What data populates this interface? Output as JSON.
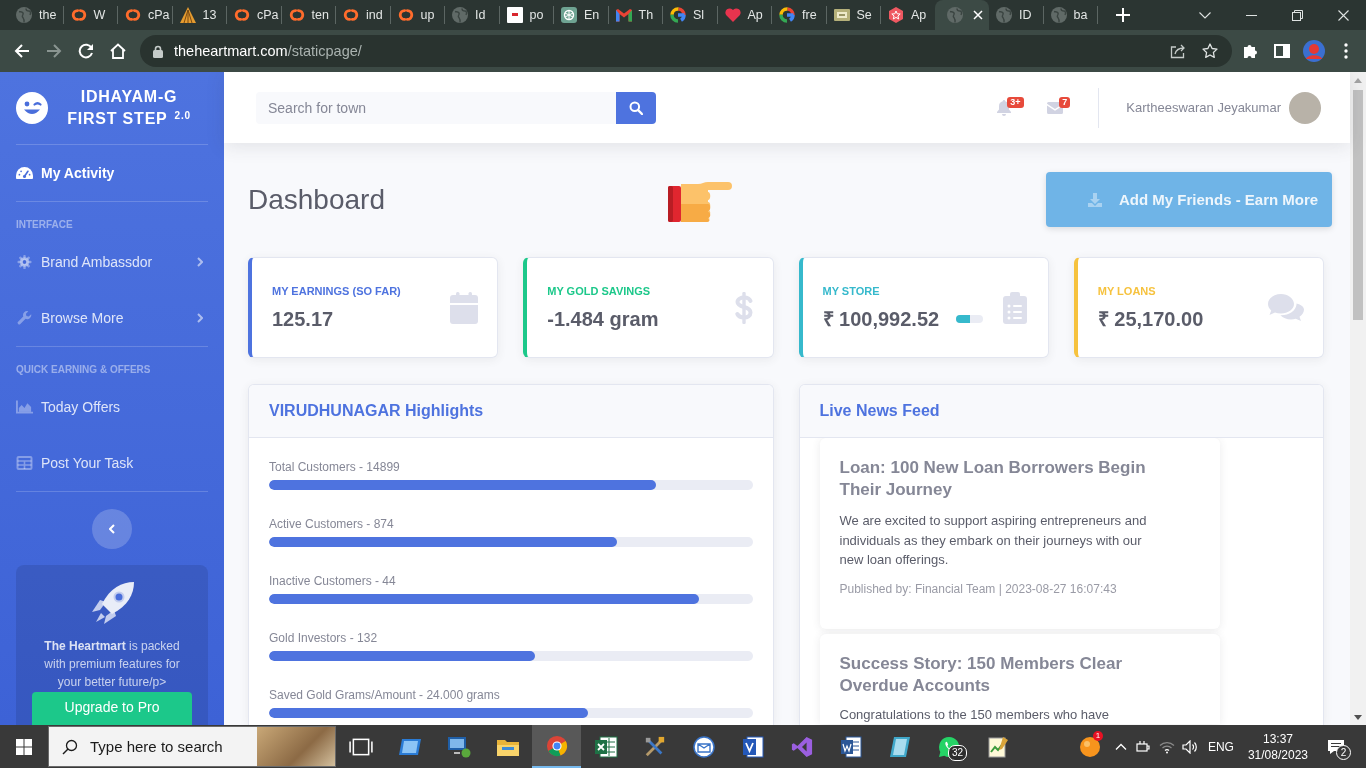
{
  "browser": {
    "tabs": [
      {
        "label": "the",
        "kind": "globe",
        "selected": false
      },
      {
        "label": "W",
        "kind": "arcs",
        "selected": false
      },
      {
        "label": "cPa",
        "kind": "arcs",
        "selected": false
      },
      {
        "label": "13",
        "kind": "tent",
        "selected": false
      },
      {
        "label": "cPa",
        "kind": "arcs",
        "selected": false
      },
      {
        "label": "ten",
        "kind": "arcs",
        "selected": false
      },
      {
        "label": "ind",
        "kind": "arcs",
        "selected": false
      },
      {
        "label": "up",
        "kind": "arcs",
        "selected": false
      },
      {
        "label": "Id",
        "kind": "globe",
        "selected": false
      },
      {
        "label": "po",
        "kind": "square",
        "selected": false
      },
      {
        "label": "En",
        "kind": "knot",
        "selected": false
      },
      {
        "label": "Th",
        "kind": "mail",
        "selected": false
      },
      {
        "label": "Sl",
        "kind": "ring",
        "selected": false
      },
      {
        "label": "Ap",
        "kind": "heart",
        "selected": false
      },
      {
        "label": "fre",
        "kind": "ring",
        "selected": false
      },
      {
        "label": "Se",
        "kind": "card",
        "selected": false
      },
      {
        "label": "Ap",
        "kind": "hexagon",
        "selected": false
      },
      {
        "kind": "globe",
        "selected": true
      },
      {
        "label": "ID",
        "kind": "globe",
        "selected": false
      },
      {
        "label": "ba",
        "kind": "globe",
        "selected": false
      }
    ],
    "address": {
      "host": "theheartmart.com",
      "path": "/staticpage/"
    }
  },
  "sidebar": {
    "brand": {
      "line1": "IDHAYAM-G",
      "line2": "FIRST STEP $^{2.0}$"
    },
    "nav": [
      {
        "kind": "link",
        "label": "My Activity",
        "selected": true,
        "expandable": false
      },
      {
        "kind": "heading",
        "label": "INTERFACE"
      },
      {
        "kind": "link",
        "label": "Brand Ambassdor",
        "selected": false,
        "expandable": true
      },
      {
        "kind": "link",
        "label": "Browse More",
        "selected": false,
        "expandable": true
      },
      {
        "kind": "heading",
        "label": "QUICK EARNING & OFFERS"
      },
      {
        "kind": "link",
        "label": "Today Offers",
        "selected": false,
        "expandable": false
      },
      {
        "kind": "link",
        "label": "Post Your Task",
        "selected": false,
        "expandable": false
      }
    ],
    "promo": {
      "text": "**The Heartmart** is packed with premium features for your better future/p>",
      "button": "Upgrade to Pro"
    }
  },
  "topbar": {
    "search": {
      "placeholder": "Search for town"
    },
    "alerts_badge": "3+",
    "messages_badge": "7",
    "user_name": "Kartheeswaran Jeyakumar"
  },
  "dashboard": {
    "title": "Dashboard",
    "action_button": "Add My Friends - Earn More",
    "stat_cards": [
      {
        "label": "MY EARNINGS (SO FAR)",
        "value": "125.17",
        "color": "#4e73df"
      },
      {
        "label": "MY GOLD SAVINGS",
        "value": "-1.484 gram",
        "color": "#1cc88a"
      },
      {
        "label": "MY STORE",
        "value": "₹ 100,992.52",
        "color": "#36b9cc",
        "level": 0.5
      },
      {
        "label": "MY LOANS",
        "value": "₹ 25,170.00",
        "color": "#f6c23e"
      }
    ],
    "highlights": {
      "title": "VIRUDHUNAGAR Highlights",
      "bars": [
        {
          "label": "Total Customers - 14899",
          "level": 0.8
        },
        {
          "label": "Active Customers - 874",
          "level": 0.72
        },
        {
          "label": "Inactive Customers - 44",
          "level": 0.89
        },
        {
          "label": "Gold Investors - 132",
          "level": 0.55
        },
        {
          "label": "Saved Gold Grams/Amount - 24.000 grams",
          "level": 0.66
        }
      ]
    },
    "news_feed": {
      "title": "Live News Feed",
      "posts": [
        {
          "title": "Loan: 100 New Loan Borrowers Begin Their Journey",
          "body": "We are excited to support aspiring entrepreneurs and individuals as they embark on their journeys with our new loan offerings.",
          "meta": "Published by: Financial Team | 2023-08-27 16:07:43"
        },
        {
          "title": "Success Story: 150 Members Clear Overdue Accounts",
          "body": "Congratulations to the 150 members who have"
        }
      ]
    }
  },
  "taskbar": {
    "search": {
      "placeholder": "Type here to search"
    },
    "apps": [
      {
        "kind": "taskview",
        "selected": false
      },
      {
        "kind": "tablet",
        "selected": false
      },
      {
        "kind": "monitor",
        "selected": false
      },
      {
        "kind": "folder",
        "selected": false
      },
      {
        "kind": "ball",
        "selected": true
      },
      {
        "kind": "sheet",
        "selected": false
      },
      {
        "kind": "tools",
        "selected": false
      },
      {
        "kind": "mail",
        "selected": false
      },
      {
        "kind": "tile",
        "selected": false
      },
      {
        "kind": "ribbon",
        "selected": false
      },
      {
        "kind": "doc",
        "selected": false
      },
      {
        "kind": "glass",
        "selected": false
      },
      {
        "kind": "chat",
        "selected": false,
        "badge": "32"
      },
      {
        "kind": "notepad",
        "selected": false
      }
    ],
    "tray": {
      "app_badge": "1",
      "language": "ENG",
      "time": "13:37",
      "date": "31/08/2023",
      "notifications": "2"
    }
  }
}
